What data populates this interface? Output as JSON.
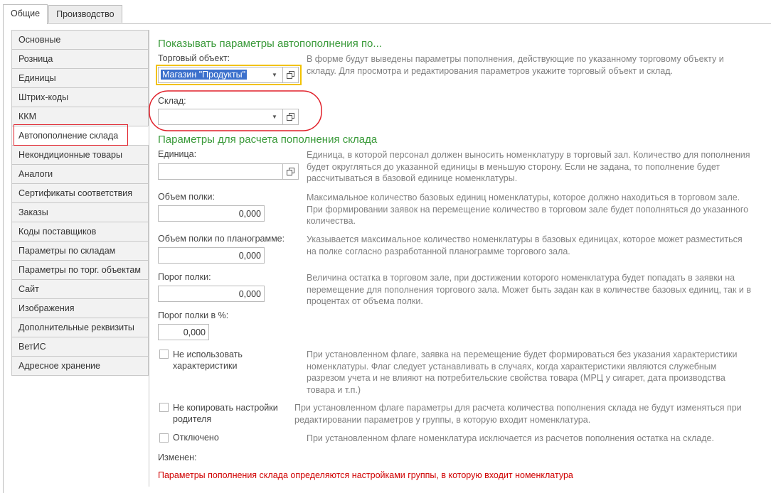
{
  "tabs": [
    "Общие",
    "Производство"
  ],
  "sidebar": {
    "items": [
      "Основные",
      "Розница",
      "Единицы",
      "Штрих-коды",
      "ККМ",
      "Автопополнение склада",
      "Некондиционные товары",
      "Аналоги",
      "Сертификаты соответствия",
      "Заказы",
      "Коды поставщиков",
      "Параметры по складам",
      "Параметры по торг. объектам",
      "Сайт",
      "Изображения",
      "Дополнительные реквизиты",
      "ВетИС",
      "Адресное хранение"
    ]
  },
  "section1": {
    "title": "Показывать параметры автопополнения по...",
    "trade_object_label": "Торговый объект:",
    "trade_object_value": "Магазин \"Продукты\"",
    "warehouse_label": "Склад:",
    "warehouse_value": "",
    "description": "В форме будут выведены параметры пополнения, действующие по указанному торговому объекту и складу. Для просмотра и редактирования параметров укажите торговый объект и склад."
  },
  "section2": {
    "title": "Параметры для расчета пополнения склада",
    "unit": {
      "label": "Единица:",
      "value": "",
      "description": "Единица, в которой персонал должен выносить номенклатуру в торговый зал. Количество для пополнения будет округляться до указанной единицы в меньшую сторону. Если не задана, то пополнение будет рассчитываться в базовой единице номенклатуры."
    },
    "shelf_volume": {
      "label": "Объем полки:",
      "value": "0,000",
      "description": "Максимальное количество базовых единиц номенклатуры, которое должно находиться в торговом зале. При формировании заявок на перемещение количество в торговом зале будет пополняться до указанного количества."
    },
    "shelf_volume_plan": {
      "label": "Объем полки по планограмме:",
      "value": "0,000",
      "description": "Указывается максимальное количество номенклатуры в базовых единицах, которое может разместиться на полке согласно разработанной планограмме торгового зала."
    },
    "shelf_threshold": {
      "label": "Порог полки:",
      "value": "0,000",
      "description": "Величина остатка в торговом зале, при достижении которого номенклатура будет попадать в заявки на перемещение для пополнения торгового зала. Может быть задан как в количестве базовых единиц, так и в процентах от объема полки."
    },
    "shelf_threshold_pct": {
      "label": "Порог полки в %:",
      "value": "0,000"
    },
    "no_characteristics": {
      "label": "Не использовать характеристики",
      "checked": false,
      "description": "При установленном флаге, заявка на перемещение будет формироваться без указания характеристики номенклатуры. Флаг следует устанавливать в случаях, когда характеристики являются служебным разрезом учета и не влияют на потребительские свойства товара (МРЦ у сигарет, дата производства товара и т.п.)"
    },
    "no_copy_parent": {
      "label": "Не копировать настройки родителя",
      "checked": false,
      "description": "При установленном флаге параметры для расчета количества пополнения склада не будут изменяться при редактировании параметров у группы, в которую входит номенклатура."
    },
    "disabled": {
      "label": "Отключено",
      "checked": false,
      "description": "При установленном флаге номенклатура исключается из расчетов пополнения остатка на складе."
    },
    "changed_label": "Изменен:",
    "warning": "Параметры пополнения склада определяются настройками группы, в которую входит номенклатура"
  },
  "colors": {
    "accent_green": "#3a9a3a",
    "highlight_red": "#e0202a",
    "focus_yellow": "#f2c200",
    "warning_red": "#d00000",
    "selection_blue": "#3b70cc"
  }
}
